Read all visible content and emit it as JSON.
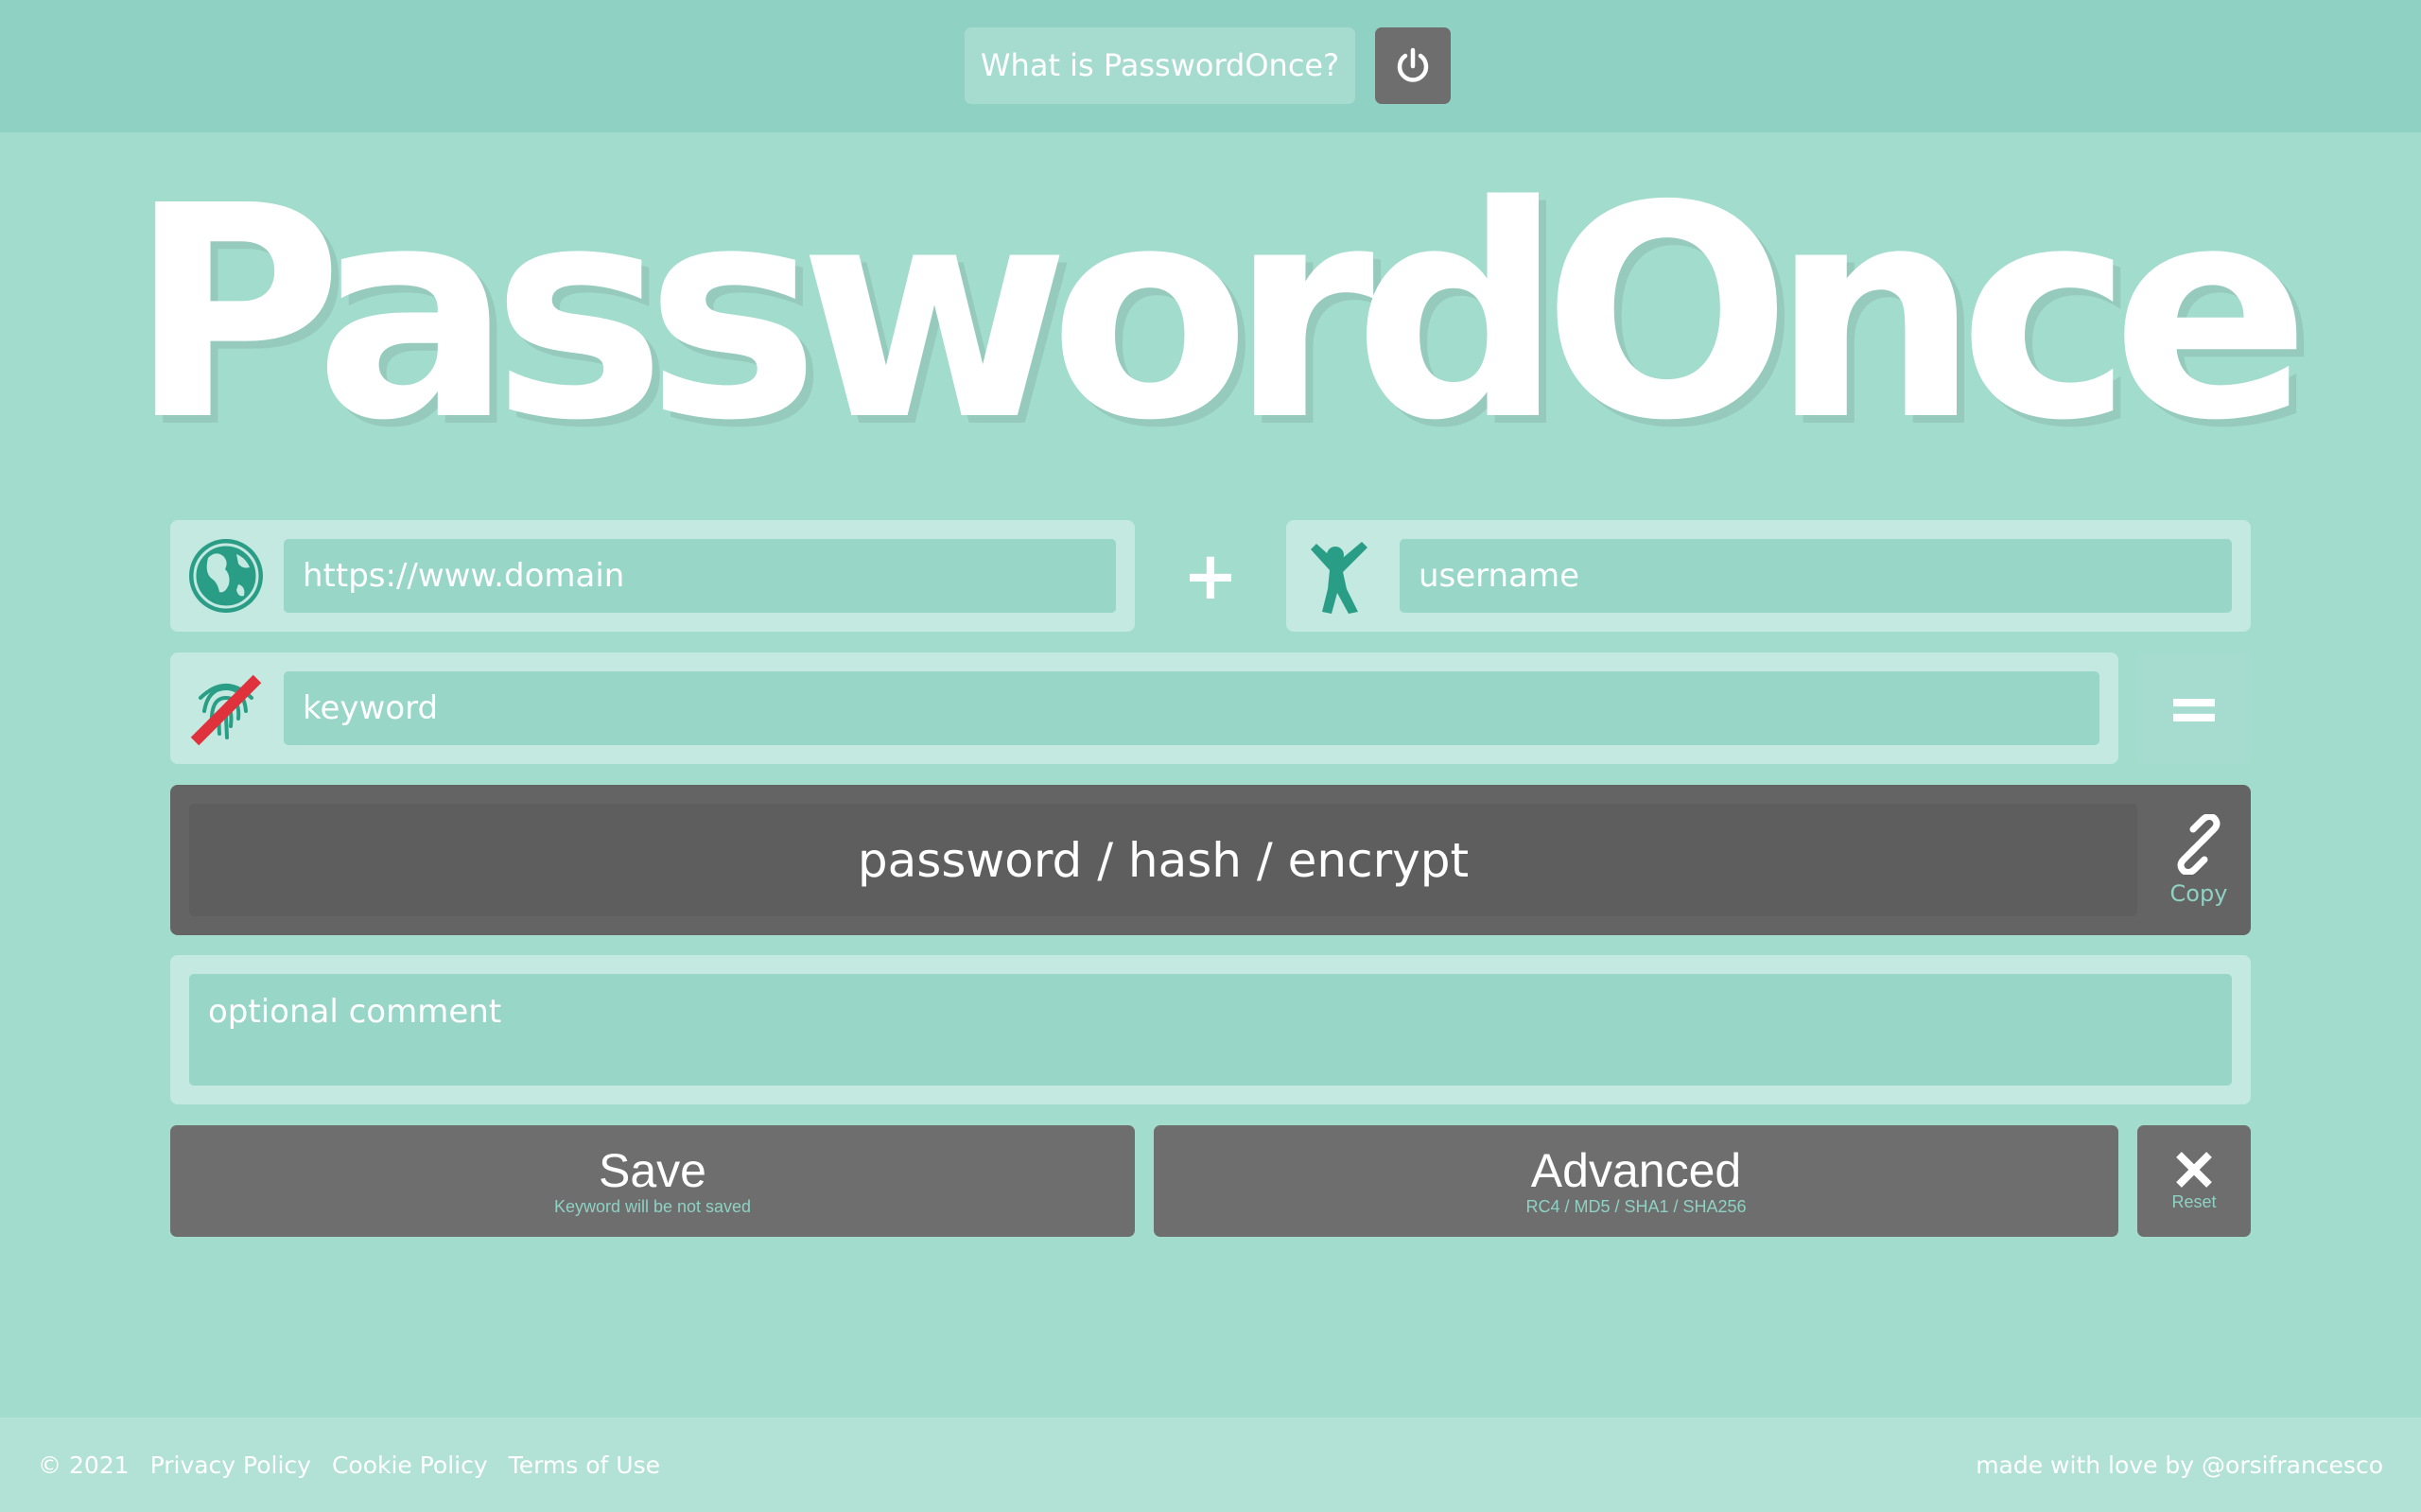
{
  "header": {
    "what_label": "What is PasswordOnce?",
    "power_icon": "power-icon"
  },
  "logo": {
    "text": "PasswordOnce"
  },
  "form": {
    "domain_placeholder": "https://www.domain",
    "plus_symbol": "+",
    "username_placeholder": "username",
    "keyword_placeholder": "keyword",
    "equals_symbol": "=",
    "output_placeholder": "password / hash / encrypt",
    "copy_label": "Copy",
    "comment_placeholder": "optional comment"
  },
  "buttons": {
    "save_label": "Save",
    "save_sub": "Keyword will be not saved",
    "advanced_label": "Advanced",
    "advanced_sub": "RC4 / MD5 / SHA1 / SHA256",
    "reset_label": "Reset"
  },
  "footer": {
    "copyright": "© 2021",
    "links": [
      "Privacy Policy",
      "Cookie Policy",
      "Terms of Use"
    ],
    "credit": "made with love by @orsifrancesco"
  },
  "colors": {
    "background": "#a2dccd",
    "topbar": "#8fd1c3",
    "accent": "#2a9d86",
    "dark": "#6e6e6e",
    "alert": "#e0323c"
  }
}
